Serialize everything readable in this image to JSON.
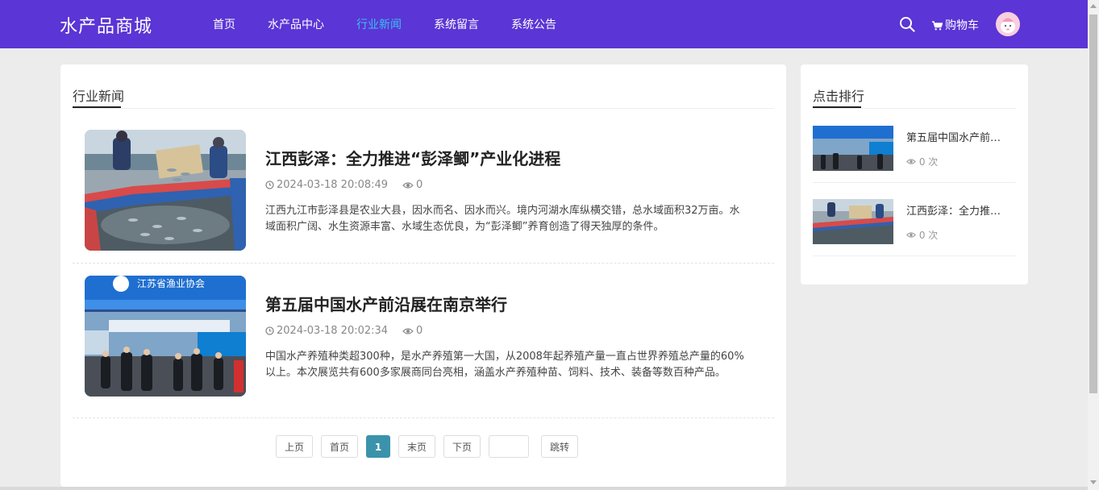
{
  "header": {
    "brand": "水产品商城",
    "nav": [
      "首页",
      "水产品中心",
      "行业新闻",
      "系统留言",
      "系统公告"
    ],
    "active_nav": "行业新闻",
    "cart_label": "购物车"
  },
  "main": {
    "section_title": "行业新闻",
    "articles": [
      {
        "title": "江西彭泽：全力推进“彭泽鲫”产业化进程",
        "date": "2024-03-18 20:08:49",
        "views": "0",
        "summary": "江西九江市彭泽县是农业大县，因水而名、因水而兴。境内河湖水库纵横交错，总水域面积32万亩。水域面积广阔、水生资源丰富、水域生态优良，为“彭泽鲫”养育创造了得天独厚的条件。"
      },
      {
        "title": "第五届中国水产前沿展在南京举行",
        "date": "2024-03-18 20:02:34",
        "views": "0",
        "summary": "中国水产养殖种类超300种，是水产养殖第一大国，从2008年起养殖产量一直占世界养殖总产量的60%以上。本次展览共有600多家展商同台亮相，涵盖水产养殖种苗、饲料、技术、装备等数百种产品。"
      }
    ],
    "image_banner_text": "江苏省渔业协会"
  },
  "pagination": {
    "prev": "上页",
    "first": "首页",
    "current": "1",
    "last": "末页",
    "next": "下页",
    "page_input": "",
    "jump": "跳转"
  },
  "sidebar": {
    "title": "点击排行",
    "items": [
      {
        "title": "第五届中国水产前沿展在南京举行",
        "views": "0 次"
      },
      {
        "title": "江西彭泽：全力推进“彭泽鲫”产业化进程",
        "views": "0 次"
      }
    ]
  },
  "colors": {
    "header_bg": "#5b35d5",
    "nav_active": "#39c0f0",
    "pagination_current": "#3a93ab"
  }
}
